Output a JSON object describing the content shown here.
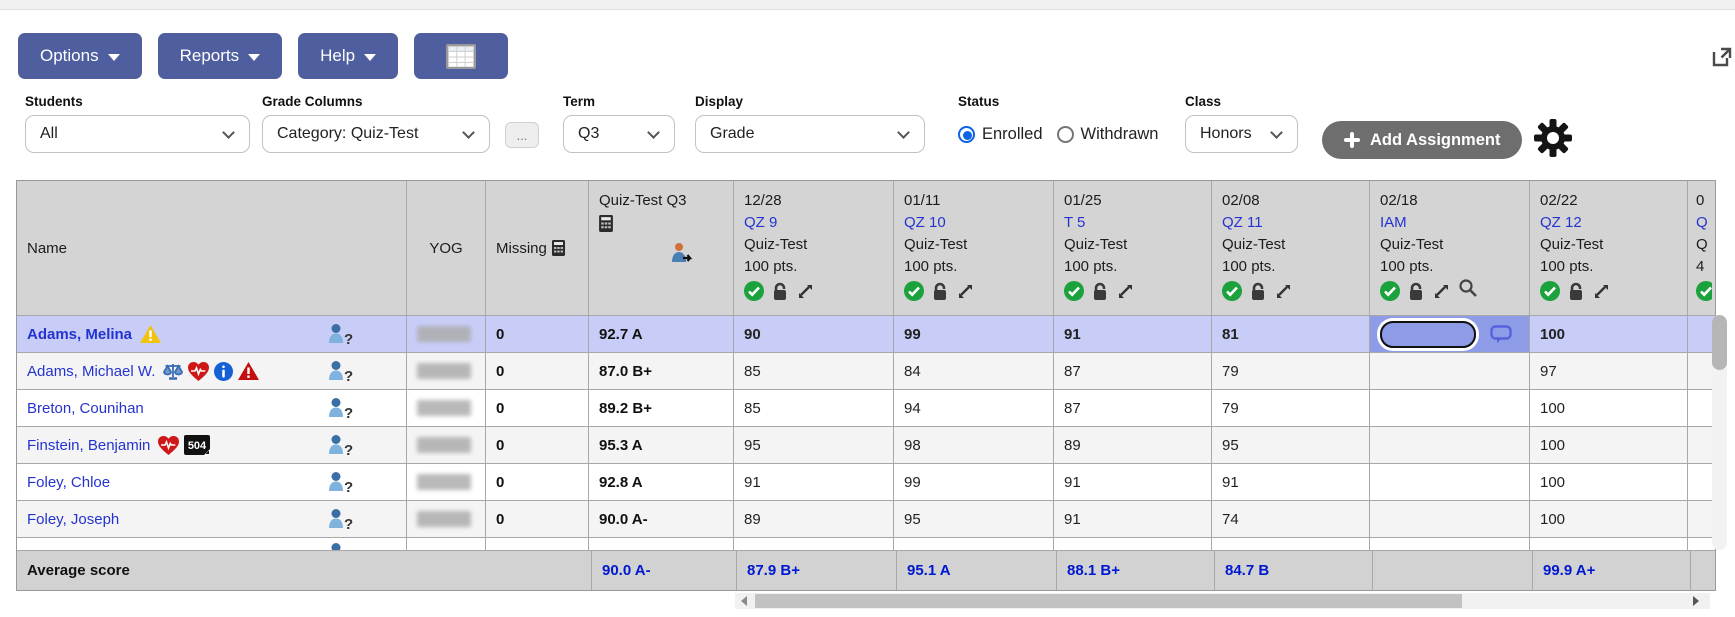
{
  "toolbar": {
    "options_label": "Options",
    "reports_label": "Reports",
    "help_label": "Help"
  },
  "filters": {
    "students": {
      "label": "Students",
      "value": "All"
    },
    "grade_columns": {
      "label": "Grade Columns",
      "value": "Category: Quiz-Test"
    },
    "more_button": "...",
    "term": {
      "label": "Term",
      "value": "Q3"
    },
    "display": {
      "label": "Display",
      "value": "Grade"
    },
    "status": {
      "label": "Status",
      "enrolled": "Enrolled",
      "withdrawn": "Withdrawn",
      "selected": "Enrolled"
    },
    "class": {
      "label": "Class",
      "value": "Honors"
    },
    "add_assignment_label": "Add Assignment"
  },
  "table": {
    "name_header": "Name",
    "yog_header": "YOG",
    "missing_header": "Missing",
    "summary_header": "Quiz-Test Q3",
    "assignments": [
      {
        "date": "12/28",
        "code": "QZ 9",
        "category": "Quiz-Test",
        "points": "100 pts."
      },
      {
        "date": "01/11",
        "code": "QZ 10",
        "category": "Quiz-Test",
        "points": "100 pts."
      },
      {
        "date": "01/25",
        "code": "T 5",
        "category": "Quiz-Test",
        "points": "100 pts."
      },
      {
        "date": "02/08",
        "code": "QZ 11",
        "category": "Quiz-Test",
        "points": "100 pts."
      },
      {
        "date": "02/18",
        "code": "IAM",
        "category": "Quiz-Test",
        "points": "100 pts."
      },
      {
        "date": "02/22",
        "code": "QZ 12",
        "category": "Quiz-Test",
        "points": "100 pts."
      }
    ],
    "partial_column": {
      "date": "0",
      "code": "Q",
      "category": "Q",
      "points": "4"
    },
    "rows": [
      {
        "name": "Adams, Melina",
        "missing": "0",
        "average": "92.7 A",
        "scores": [
          "90",
          "99",
          "91",
          "81",
          "",
          "100"
        ]
      },
      {
        "name": "Adams, Michael W.",
        "missing": "0",
        "average": "87.0 B+",
        "scores": [
          "85",
          "84",
          "87",
          "79",
          "",
          "97"
        ]
      },
      {
        "name": "Breton, Counihan",
        "missing": "0",
        "average": "89.2 B+",
        "scores": [
          "85",
          "94",
          "87",
          "79",
          "",
          "100"
        ]
      },
      {
        "name": "Finstein, Benjamin",
        "missing": "0",
        "average": "95.3 A",
        "scores": [
          "95",
          "98",
          "89",
          "95",
          "",
          "100"
        ]
      },
      {
        "name": "Foley, Chloe",
        "missing": "0",
        "average": "92.8 A",
        "scores": [
          "91",
          "99",
          "91",
          "91",
          "",
          "100"
        ]
      },
      {
        "name": "Foley, Joseph",
        "missing": "0",
        "average": "90.0 A-",
        "scores": [
          "89",
          "95",
          "91",
          "74",
          "",
          "100"
        ]
      }
    ],
    "average_row": {
      "label": "Average score",
      "summary": "90.0 A-",
      "values": [
        "87.9 B+",
        "95.1 A",
        "88.1 B+",
        "84.7 B",
        "",
        "99.9 A+"
      ]
    },
    "badge_504": "504"
  },
  "colors": {
    "toolbar_button": "#4e5e9e",
    "add_button": "#6e6e6e",
    "selected_row": "#c7cdf7",
    "selected_cell": "#8e9ce8",
    "header_gray": "#d4d4d4",
    "average_row": "#d2d2d2",
    "link_blue": "#2433cf",
    "average_value_blue": "#0018cf",
    "radio_blue": "#0b63e5",
    "check_green": "#1ba23c"
  }
}
